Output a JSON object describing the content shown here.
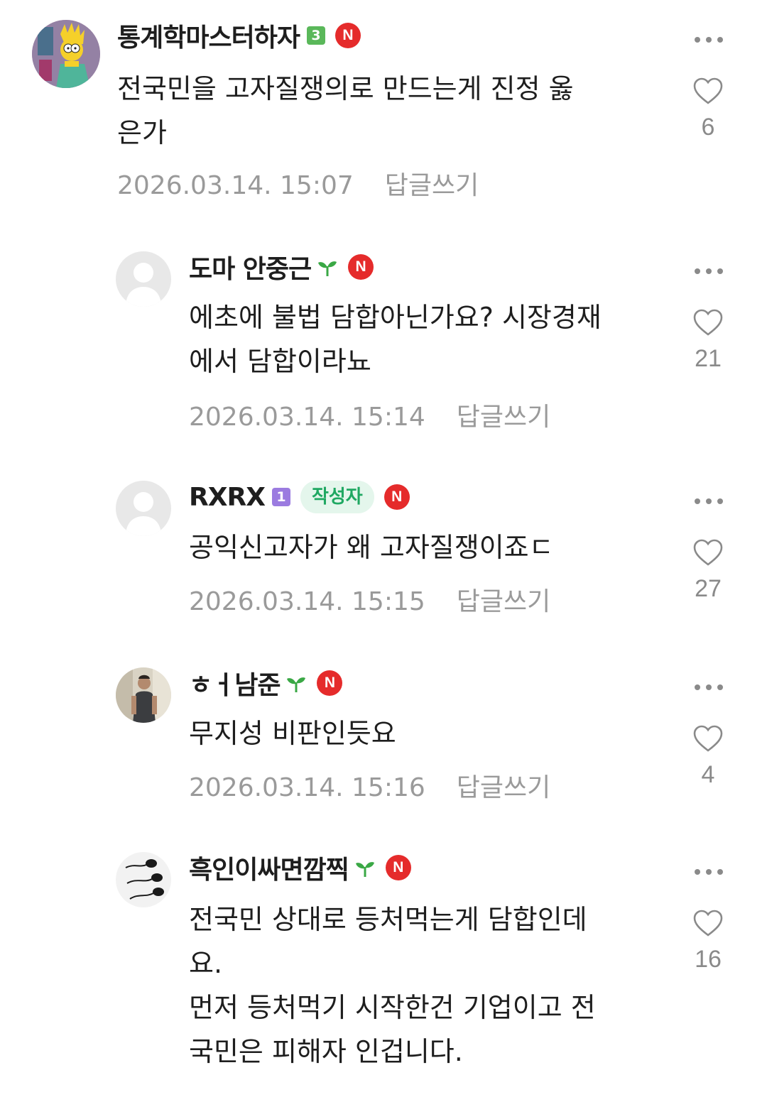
{
  "comments": [
    {
      "nickname": "통계학마스터하자",
      "level": "3",
      "level_color": "#5ab85a",
      "nbadge": "N",
      "text": "전국민을 고자질쟁의로 만드는게 진정 옳\n은가",
      "timestamp": "2026.03.14. 15:07",
      "reply_label": "답글쓰기",
      "likes": "6",
      "avatar": "cartoon-avatar-icon"
    },
    {
      "nickname": "도마 안중근",
      "sprout": "sprout-icon",
      "nbadge": "N",
      "text": "에초에 불법 담합아닌가요? 시장경재\n에서 담합이라뇨",
      "timestamp": "2026.03.14. 15:14",
      "reply_label": "답글쓰기",
      "likes": "21",
      "avatar": "default-avatar-icon"
    },
    {
      "nickname": "RXRX",
      "level": "1",
      "level_color": "#9b7be0",
      "author_badge": "작성자",
      "nbadge": "N",
      "text": "공익신고자가 왜 고자질쟁이죠ㄷ",
      "timestamp": "2026.03.14. 15:15",
      "reply_label": "답글쓰기",
      "likes": "27",
      "avatar": "default-avatar-icon"
    },
    {
      "nickname": "ㅎㅓ남준",
      "sprout": "sprout-icon",
      "nbadge": "N",
      "text": "무지성 비판인듯요",
      "timestamp": "2026.03.14. 15:16",
      "reply_label": "답글쓰기",
      "likes": "4",
      "avatar": "photo-avatar-icon"
    },
    {
      "nickname": "흑인이싸면깜찍",
      "sprout": "sprout-icon",
      "nbadge": "N",
      "text": "전국민 상대로 등처먹는게 담합인데\n요.\n먼저 등처먹기 시작한건 기업이고 전\n국민은 피해자 인겁니다.",
      "likes": "16",
      "avatar": "sperm-avatar-icon"
    }
  ],
  "colors": {
    "text": "#1e1e1e",
    "meta": "#9a9a9a",
    "nbadge": "#e52b2b",
    "author_badge_bg": "#e4f6ec",
    "author_badge_text": "#1fa862",
    "sprout": "#3aa845"
  }
}
